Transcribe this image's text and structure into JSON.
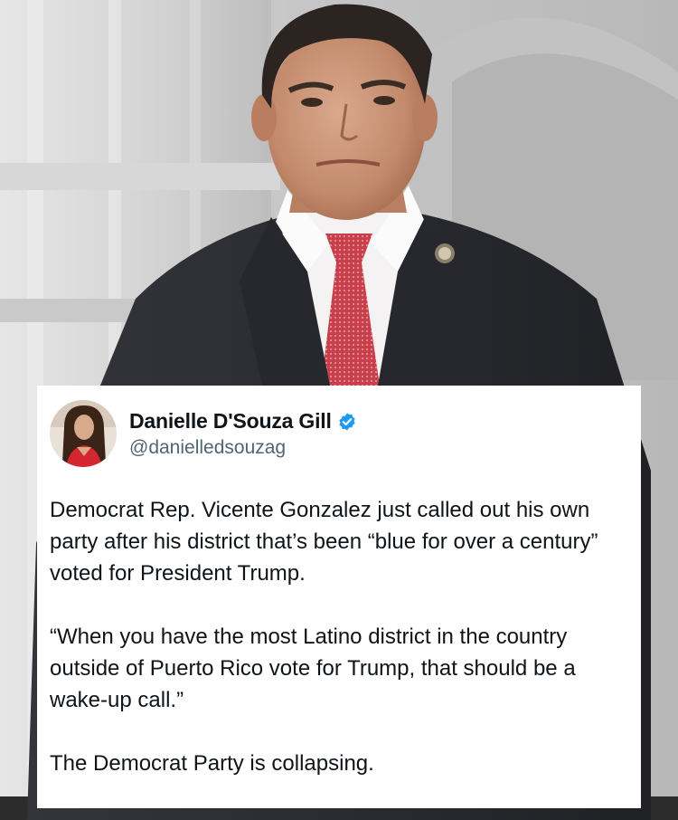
{
  "tweet": {
    "author_name": "Danielle D'Souza Gill",
    "handle": "@danielledsouzag",
    "verified": true,
    "paragraphs": [
      "Democrat Rep. Vicente Gonzalez just called out his own party after his district that’s been “blue for over a century” voted for President Trump.",
      "“When you have the most Latino district in the country outside of Puerto Rico vote for Trump, that should be a wake-up call.”",
      "The Democrat Party is collapsing."
    ]
  },
  "icons": {
    "verified": "verified-badge-icon",
    "avatar": "profile-photo"
  },
  "colors": {
    "card_background": "#ffffff",
    "text_primary": "#0f1419",
    "text_secondary": "#536471",
    "verified_blue": "#1d9bf0",
    "tie_red": "#c8404c",
    "suit": "#2a2c31"
  }
}
